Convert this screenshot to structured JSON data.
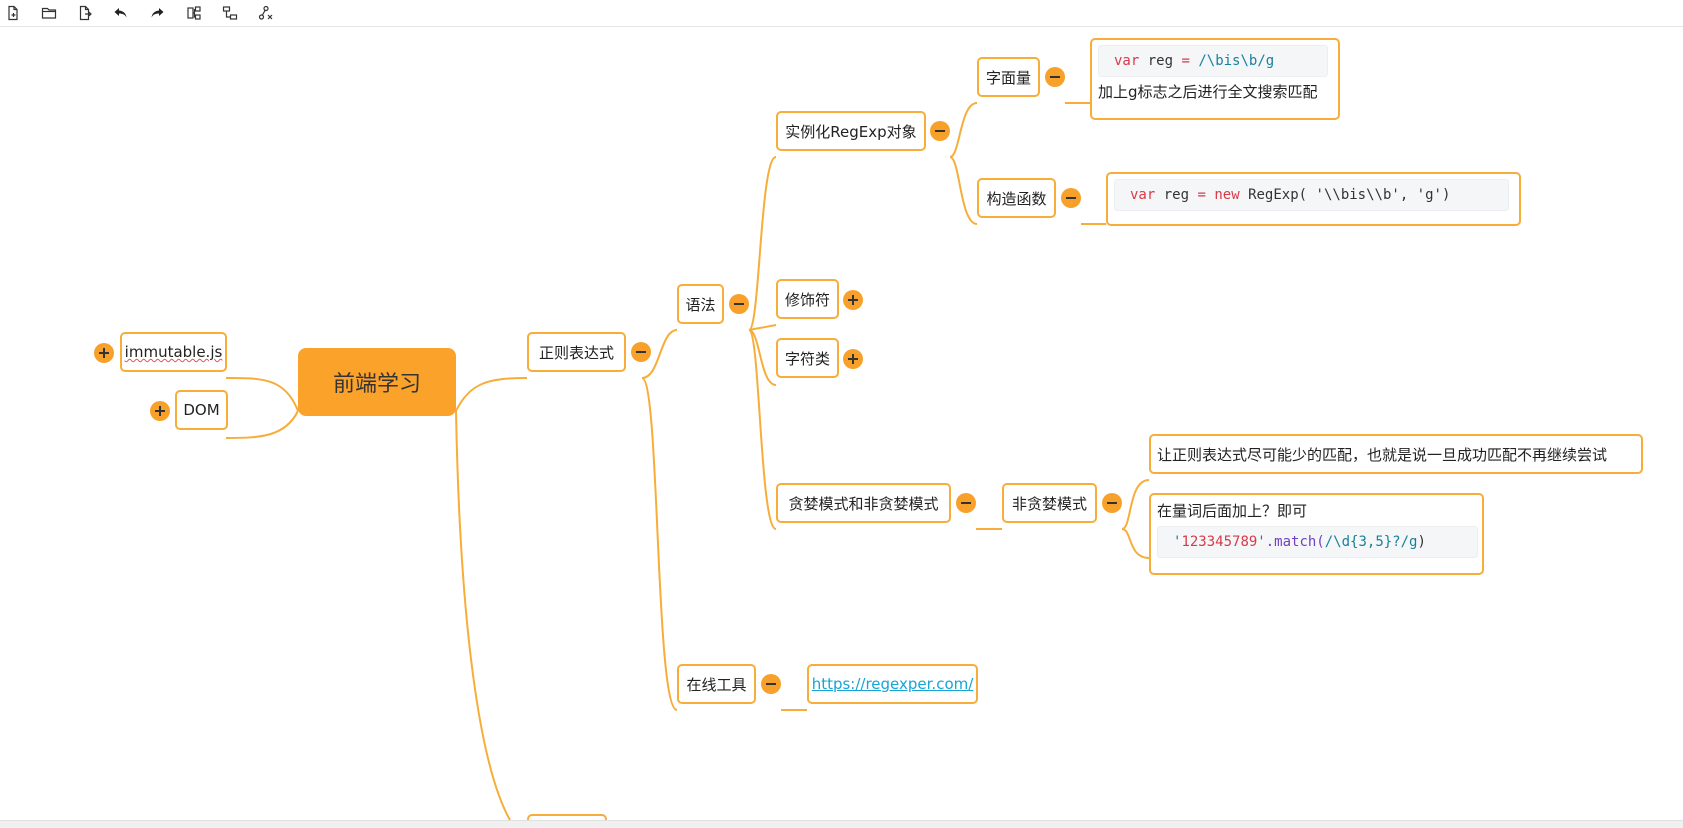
{
  "toolbar": {
    "buttons": [
      {
        "name": "new-file-icon"
      },
      {
        "name": "open-folder-icon"
      },
      {
        "name": "export-icon"
      },
      {
        "name": "undo-icon"
      },
      {
        "name": "redo-icon"
      },
      {
        "name": "add-child-node-icon"
      },
      {
        "name": "add-sibling-node-icon"
      },
      {
        "name": "delete-node-icon"
      }
    ]
  },
  "mindmap": {
    "root": "前端学习",
    "left": {
      "immutable": "immutable.js",
      "dom": "DOM"
    },
    "regex": {
      "label": "正则表达式",
      "syntax": {
        "label": "语法",
        "instantiate": {
          "label": "实例化RegExp对象",
          "literal": {
            "label": "字面量",
            "code_var": "var",
            "code_name": "reg",
            "code_eq": "=",
            "code_value": "/\\bis\\b/g",
            "note": "加上g标志之后进行全文搜索匹配"
          },
          "constructor": {
            "label": "构造函数",
            "code_var": "var",
            "code_name": "reg",
            "code_eq": "=",
            "code_new": "new",
            "code_call": "RegExp(",
            "code_args": "'\\\\bis\\\\b', 'g'",
            "code_close": ")"
          }
        },
        "modifiers": "修饰符",
        "char_class": "字符类",
        "greedy": {
          "label": "贪婪模式和非贪婪模式",
          "nongreedy": {
            "label": "非贪婪模式",
            "note1": "让正则表达式尽可能少的匹配，也就是说一旦成功匹配不再继续尝试",
            "note2": "在量词后面加上？即可",
            "code_q1": "'",
            "code_str": "123345789",
            "code_q2": "'",
            "code_method": ".match(",
            "code_regex": "/\\d{3,5}?/g",
            "code_close": ")"
          }
        }
      },
      "tools": {
        "label": "在线工具",
        "url": "https://regexper.com/"
      }
    }
  },
  "colors": {
    "accent": "#f7ad3a",
    "root_fill": "#fba22b",
    "link": "#17a4d6"
  }
}
